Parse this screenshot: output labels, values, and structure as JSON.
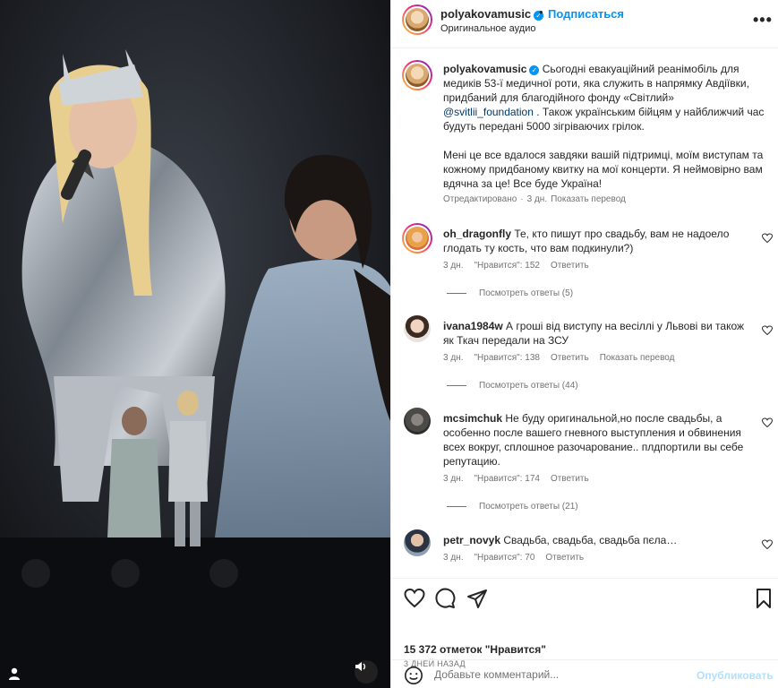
{
  "header": {
    "username": "polyakovamusic",
    "separator": "•",
    "follow_label": "Подписаться",
    "audio": "Оригинальное аудио",
    "more": "•••"
  },
  "caption": {
    "username": "polyakovamusic",
    "text_part1": " Сьогодні евакуаційний реанімобіль для медиків 53-ї медичної роти, яка служить в напрямку Авдіївки, придбаний для благодійного фонду «Світлий» ",
    "mention": "@svitlii_foundation",
    "text_part2": " . Також українським бійцям у найближчий час будуть передані 5000 зігріваючих грілок.",
    "paragraph2": "Мені це все вдалося завдяки вашій підтримці, моїм виступам та кожному придбаному квитку на мої концерти. Я неймовірно вам вдячна за це! Все буде Україна!",
    "edited": "Отредактировано",
    "dot": "·",
    "time": "3 дн.",
    "translate": "Показать перевод"
  },
  "comments": [
    {
      "username": "oh_dragonfly",
      "text": " Те, кто пишут про свадьбу, вам не надоело глодать ту кость, что вам подкинули?)",
      "time": "3 дн.",
      "likes": "\"Нравится\": 152",
      "reply": "Ответить",
      "translate": "",
      "replies": "Посмотреть ответы (5)"
    },
    {
      "username": "ivana1984w",
      "text": " А гроші від виступу на весіллі у Львові ви також як Ткач передали на ЗСУ",
      "time": "3 дн.",
      "likes": "\"Нравится\": 138",
      "reply": "Ответить",
      "translate": "Показать перевод",
      "replies": "Посмотреть ответы (44)"
    },
    {
      "username": "mcsimchuk",
      "text": " Не буду оригинальной,но после свадьбы, а особенно после вашего гневного выступления и обвинения всех вокруг, сплошное разочарование.. плдпортили вы себе репутацию.",
      "time": "3 дн.",
      "likes": "\"Нравится\": 174",
      "reply": "Ответить",
      "translate": "",
      "replies": "Посмотреть ответы (21)"
    },
    {
      "username": "petr_novyk",
      "text": " Свадьба, свадьба, свадьба пєла…",
      "time": "3 дн.",
      "likes": "\"Нравится\": 70",
      "reply": "Ответить",
      "translate": "",
      "replies": ""
    }
  ],
  "footer": {
    "likes": "15 372 отметок \"Нравится\"",
    "when": "3 ДНЕЙ НАЗАД",
    "placeholder": "Добавьте комментарий...",
    "publish": "Опубликовать"
  },
  "colors": {
    "accent": "#0095f6",
    "publish_disabled": "#b2dffc",
    "muted": "#737373",
    "text": "#262626"
  },
  "icons": [
    "verified-icon",
    "more-icon",
    "heart-icon",
    "comment-icon",
    "share-icon",
    "bookmark-icon",
    "emoji-icon",
    "sound-icon",
    "user-tag-icon"
  ]
}
